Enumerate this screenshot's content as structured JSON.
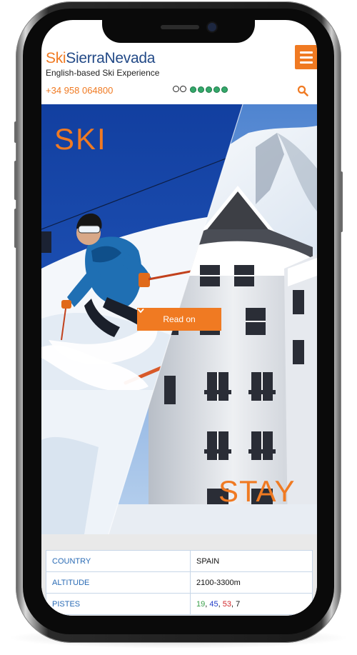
{
  "site": {
    "logo_ski": "Ski",
    "logo_rest": "SierraNevada",
    "tagline": "English-based Ski Experience",
    "phone": "+34 958 064800",
    "menu_icon": "hamburger-icon",
    "search_icon": "search-icon",
    "tripadvisor_rating_dots": 5
  },
  "hero": {
    "left_heading": "SKI",
    "right_heading": "STAY",
    "cta_label": "Read on"
  },
  "info": {
    "rows": [
      {
        "key": "COUNTRY",
        "value": "SPAIN"
      },
      {
        "key": "ALTITUDE",
        "value": "2100-3300m"
      },
      {
        "key": "PISTES",
        "pistes": {
          "green": "19",
          "blue": "45",
          "red": "53",
          "black": "7"
        }
      }
    ]
  },
  "colors": {
    "accent": "#f07a22",
    "brand_blue": "#234a87",
    "table_key": "#2a6bb5",
    "piste_green": "#3aa04a",
    "piste_blue": "#1f3bc8",
    "piste_red": "#d1262a",
    "piste_black": "#111111"
  }
}
